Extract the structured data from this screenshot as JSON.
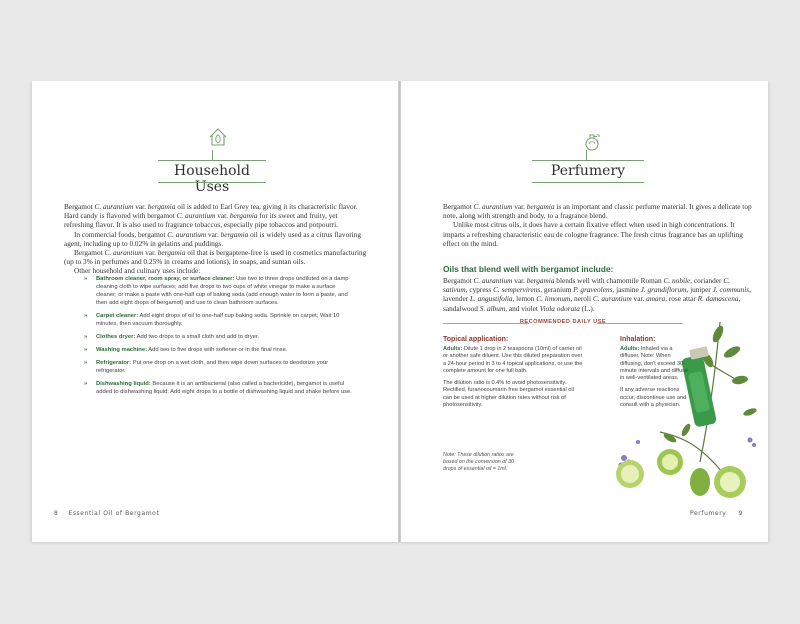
{
  "left": {
    "title": "Household Uses",
    "icon": "house-leaf-icon",
    "paragraphs": [
      [
        "Bergamot ",
        {
          "i": "C. aurantium"
        },
        " var. ",
        {
          "i": "bergamia"
        },
        " oil is added to Earl Grey tea, giving it its characteristic flavor. Hard candy is flavored with bergamot ",
        {
          "i": "C. aurantium"
        },
        " var. ",
        {
          "i": "bergamia"
        },
        " for its sweet and fruity, yet refreshing flavor. It is also used to fragrance tobaccos, especially pipe tobaccos and potpourri."
      ],
      [
        "In commercial foods, bergamot ",
        {
          "i": "C. aurantium"
        },
        " var. ",
        {
          "i": "bergamia"
        },
        " oil is widely used as a citrus flavoring agent, including up to 0.02% in gelatins and puddings."
      ],
      [
        "Bergamot ",
        {
          "i": "C. aurantium"
        },
        " var. ",
        {
          "i": "bergamia"
        },
        " oil that is bergaptene-free is used in cosmetics manufacturing (up to 3% in perfumes and 0.25% in creams and lotions), in soaps, and suntan oils."
      ],
      [
        "Other household and culinary uses include:"
      ]
    ],
    "uses": [
      {
        "term": "Bathroom cleaner, room spray, or surface cleaner:",
        "text": " Use two to three drops undiluted on a damp cleaning cloth to wipe surfaces; add five drops to two cups of white vinegar to make a surface cleaner; or make a paste with one-half cup of baking soda (add enough water to form a paste, and then add eight drops of bergamot) and use to clean bathroom surfaces."
      },
      {
        "term": "Carpet cleaner:",
        "text": " Add eight drops of oil to one-half cup baking soda. Sprinkle on carpet; Wait 10 minutes, then vacuum thoroughly."
      },
      {
        "term": "Clothes dryer:",
        "text": " Add two drops to a small cloth and add to dryer."
      },
      {
        "term": "Washing machine:",
        "text": " Add two to five drops with softener or in the final rinse."
      },
      {
        "term": "Refrigerator:",
        "text": " Put one drop on a wet cloth, and then wipe down surfaces to deodorize your refrigerator."
      },
      {
        "term": "Dishwashing liquid:",
        "text": " Because it is an antibacterial (also called a bactericide), bergamot is useful added to dishwashing liquid: Add eight drops to a bottle of dishwashing liquid and shake before use."
      }
    ],
    "footer_num": "8",
    "footer_text": "Essential Oil of Bergamot"
  },
  "right": {
    "title": "Perfumery",
    "icon": "perfume-bottle-icon",
    "paragraphs": [
      [
        "Bergamot ",
        {
          "i": "C. aurantium"
        },
        " var. ",
        {
          "i": "bergamia"
        },
        " is an important and classic perfume material. It gives a delicate top note, along with strength and body, to a fragrance blend."
      ],
      [
        "Unlike most citrus oils, it does have a certain fixative effect when used in high concentrations. It imparts a refreshing characteristic eau de cologne fragrance. The fresh citrus fragrance has an uplifting effect on the mind."
      ]
    ],
    "blend_heading": "Oils that blend well with bergamot include:",
    "blend_text": [
      "Bergamot ",
      {
        "i": "C. aurantium"
      },
      " var. ",
      {
        "i": "bergamia"
      },
      " blends well with chamomile Roman ",
      {
        "i": "C. nobile"
      },
      ", coriander ",
      {
        "i": "C. sativum"
      },
      ", cypress ",
      {
        "i": "C. sempervirens"
      },
      ", geranium ",
      {
        "i": "P. graveolens"
      },
      ", jasmine ",
      {
        "i": "J. grandiflorum"
      },
      ", juniper ",
      {
        "i": "J. communis"
      },
      ", lavender ",
      {
        "i": "L. angustifolia"
      },
      ", lemon ",
      {
        "i": "C. limonum"
      },
      ", neroli ",
      {
        "i": "C. aurantium"
      },
      " var. ",
      {
        "i": "amara"
      },
      ", rose attar ",
      {
        "i": "R. damascena"
      },
      ", sandalwood ",
      {
        "i": "S. album"
      },
      ", and violet ",
      {
        "i": "Viola odorata"
      },
      " (L.)."
    ],
    "recommended_label": "RECOMMENDED DAILY USE",
    "topical": {
      "heading": "Topical application:",
      "lead": "Adults:",
      "text": " Dilute 1 drop in 2 teaspoons (10ml) of carrier oil or another safe diluent. Use this diluted preparation over a 24-hour period in 3 to 4 topical applications, or use the complete amount for one full bath.",
      "text2": "The dilution ratio is 0.4% to avoid photosensitivity. Rectified, furanocoumarin free bergamot essential oil can be used at higher dilution rates without risk of photosensitivity."
    },
    "inhalation": {
      "heading": "Inhalation:",
      "lead": "Adults:",
      "text": " Inhaled via a diffuser. Note: When diffusing, don't exceed 30-minute intervals and diffuse in well-ventilated areas.",
      "text2": "If any adverse reactions occur, discontinue use and consult with a physician."
    },
    "note": "Note: These dilution ratios are based on the conversion of 30 drops of essential oil = 1ml.",
    "footer_num": "9",
    "footer_text": "Perfumery"
  },
  "colors": {
    "accent_green": "#2e6b3a",
    "accent_red": "#8a3a2e",
    "rule_green": "#7a9f73"
  }
}
